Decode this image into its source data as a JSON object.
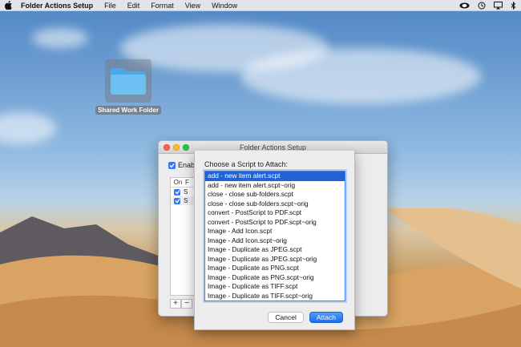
{
  "menubar": {
    "app_name": "Folder Actions Setup",
    "items": [
      "File",
      "Edit",
      "Format",
      "View",
      "Window"
    ]
  },
  "desktop": {
    "folder_label": "Shared Work Folder"
  },
  "window": {
    "title": "Folder Actions Setup",
    "enable_label": "Enable",
    "table_header_on": "On",
    "table_header_folder": "F",
    "rows": [
      "S",
      "S"
    ]
  },
  "sheet": {
    "label": "Choose a Script to Attach:",
    "scripts": [
      "add - new item alert.scpt",
      "add - new item alert.scpt~orig",
      "close - close sub-folders.scpt",
      "close - close sub-folders.scpt~orig",
      "convert - PostScript to PDF.scpt",
      "convert - PostScript to PDF.scpt~orig",
      "Image - Add Icon.scpt",
      "Image - Add Icon.scpt~orig",
      "Image - Duplicate as JPEG.scpt",
      "Image - Duplicate as JPEG.scpt~orig",
      "Image - Duplicate as PNG.scpt",
      "Image - Duplicate as PNG.scpt~orig",
      "Image - Duplicate as TIFF.scpt",
      "Image - Duplicate as TIFF.scpt~orig"
    ],
    "selected_index": 0,
    "cancel_label": "Cancel",
    "attach_label": "Attach"
  },
  "colors": {
    "accent": "#3478f6",
    "selection": "#1f63d6"
  }
}
